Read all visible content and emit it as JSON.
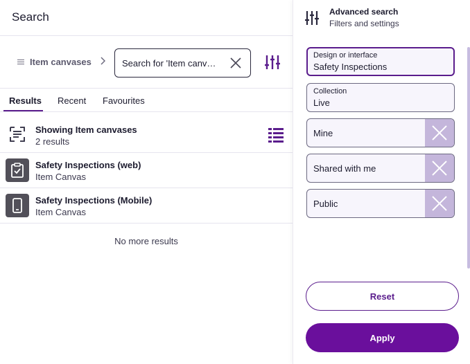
{
  "header": {
    "title": "Search"
  },
  "breadcrumb": {
    "label": "Item canvases"
  },
  "search": {
    "value": "Search for 'Item canva...",
    "placeholder": "Search for 'Item canva..."
  },
  "tabs": [
    {
      "label": "Results",
      "active": true
    },
    {
      "label": "Recent",
      "active": false
    },
    {
      "label": "Favourites",
      "active": false
    }
  ],
  "summary": {
    "title": "Showing Item canvases",
    "count": "2 results"
  },
  "results": [
    {
      "title": "Safety Inspections (web)",
      "type": "Item Canvas",
      "icon": "clipboard-check-icon"
    },
    {
      "title": "Safety Inspections (Mobile)",
      "type": "Item Canvas",
      "icon": "mobile-device-icon"
    }
  ],
  "no_more": "No more results",
  "advanced": {
    "title": "Advanced search",
    "subtitle": "Filters and settings",
    "fields": [
      {
        "label": "Design or interface",
        "value": "Safety Inspections"
      },
      {
        "label": "Collection",
        "value": "Live"
      }
    ],
    "chips": [
      {
        "label": "Mine"
      },
      {
        "label": "Shared with me"
      },
      {
        "label": "Public"
      }
    ],
    "reset_label": "Reset",
    "apply_label": "Apply"
  },
  "colors": {
    "accent": "#6a0f9c",
    "chip_remove": "#c4b6db",
    "icon_tile": "#525059"
  }
}
